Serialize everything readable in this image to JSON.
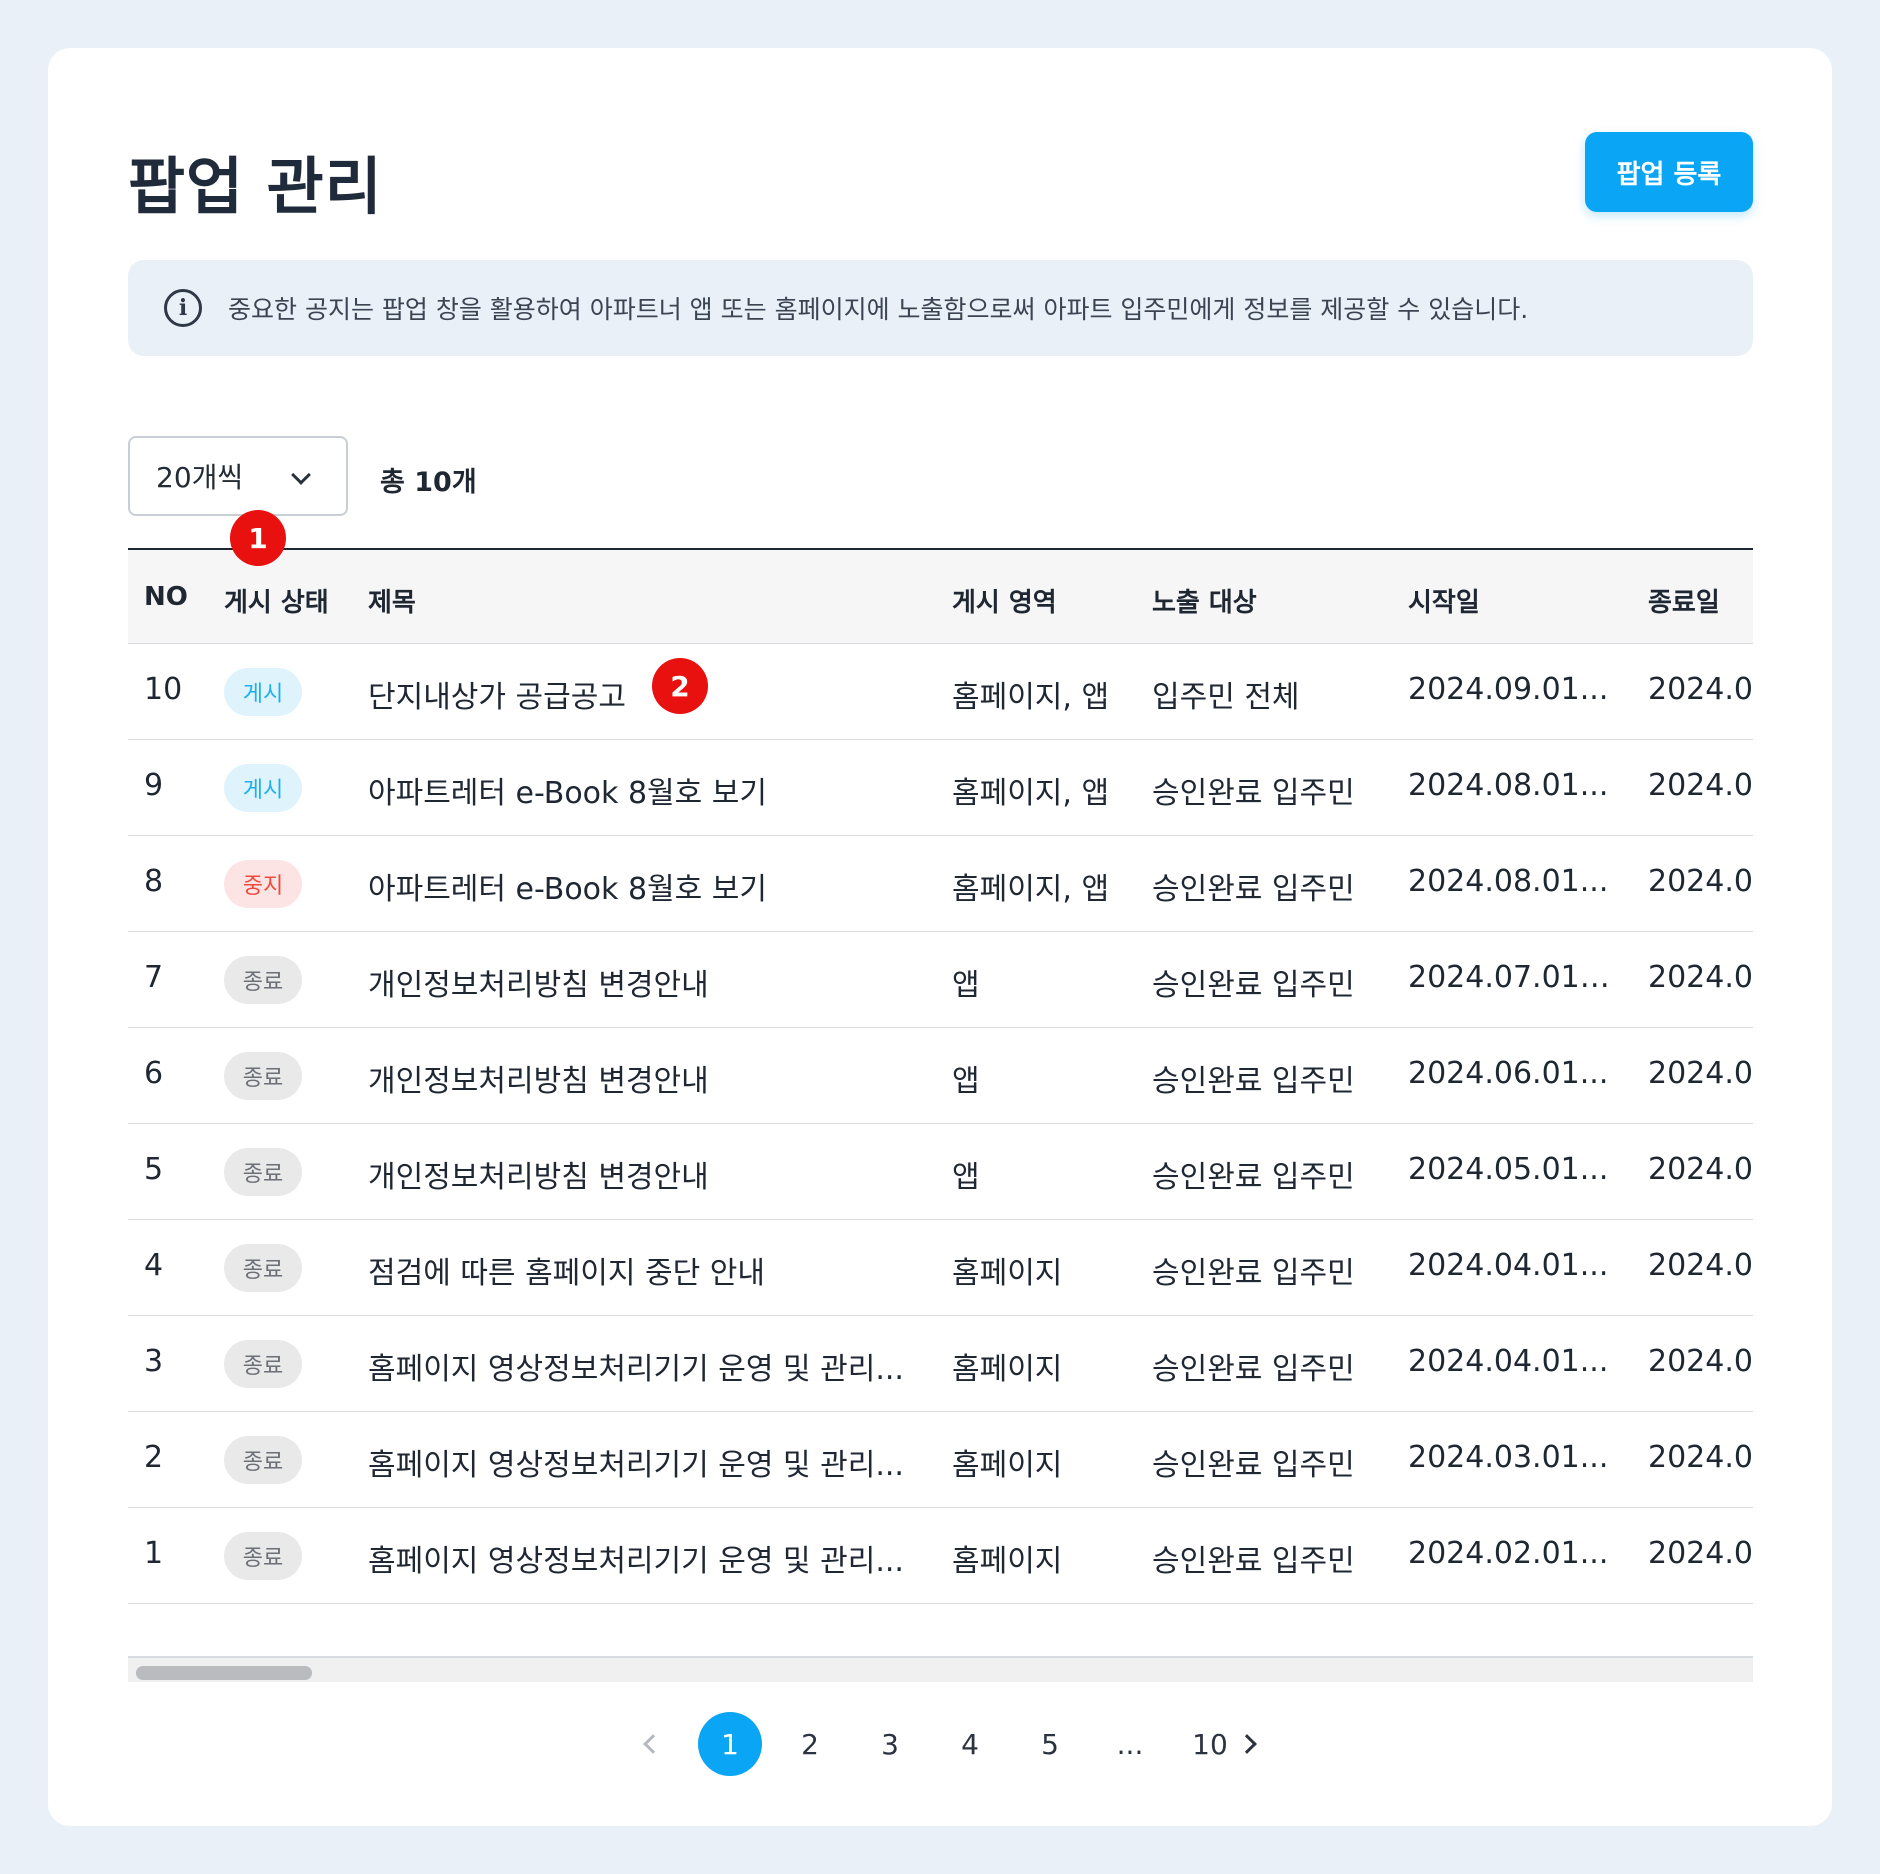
{
  "header": {
    "title": "팝업 관리",
    "register_button": "팝업 등록"
  },
  "notice": {
    "icon": "info-icon",
    "icon_glyph": "i",
    "text": "중요한 공지는 팝업 창을 활용하여 아파트너 앱 또는 홈페이지에 노출함으로써 아파트 입주민에게 정보를 제공할 수 있습니다."
  },
  "controls": {
    "page_size": "20개씩",
    "total": "총 10개"
  },
  "markers": {
    "one": "1",
    "two": "2"
  },
  "table": {
    "columns": {
      "no": "NO",
      "status": "게시 상태",
      "title": "제목",
      "area": "게시 영역",
      "target": "노출 대상",
      "start": "시작일",
      "end": "종료일"
    },
    "rows": [
      {
        "no": "10",
        "status": "게시",
        "title": "단지내상가 공급공고",
        "area": "홈페이지, 앱",
        "target": "입주민 전체",
        "start": "2024.09.01...",
        "end": "2024.0"
      },
      {
        "no": "9",
        "status": "게시",
        "title": "아파트레터 e-Book 8월호 보기",
        "area": "홈페이지, 앱",
        "target": "승인완료 입주민",
        "start": "2024.08.01...",
        "end": "2024.0"
      },
      {
        "no": "8",
        "status": "중지",
        "title": "아파트레터 e-Book 8월호 보기",
        "area": "홈페이지, 앱",
        "target": "승인완료 입주민",
        "start": "2024.08.01...",
        "end": "2024.0"
      },
      {
        "no": "7",
        "status": "종료",
        "title": "개인정보처리방침 변경안내",
        "area": "앱",
        "target": "승인완료 입주민",
        "start": "2024.07.01 0...",
        "end": "2024.0"
      },
      {
        "no": "6",
        "status": "종료",
        "title": "개인정보처리방침 변경안내",
        "area": "앱",
        "target": "승인완료 입주민",
        "start": "2024.06.01...",
        "end": "2024.0"
      },
      {
        "no": "5",
        "status": "종료",
        "title": "개인정보처리방침 변경안내",
        "area": "앱",
        "target": "승인완료 입주민",
        "start": "2024.05.01...",
        "end": "2024.0"
      },
      {
        "no": "4",
        "status": "종료",
        "title": "점검에 따른 홈페이지 중단 안내",
        "area": "홈페이지",
        "target": "승인완료 입주민",
        "start": "2024.04.01...",
        "end": "2024.0"
      },
      {
        "no": "3",
        "status": "종료",
        "title": "홈페이지 영상정보처리기기 운영 및 관리...",
        "area": "홈페이지",
        "target": "승인완료 입주민",
        "start": "2024.04.01...",
        "end": "2024.0"
      },
      {
        "no": "2",
        "status": "종료",
        "title": "홈페이지 영상정보처리기기 운영 및 관리...",
        "area": "홈페이지",
        "target": "승인완료 입주민",
        "start": "2024.03.01...",
        "end": "2024.0"
      },
      {
        "no": "1",
        "status": "종료",
        "title": "홈페이지 영상정보처리기기 운영 및 관리...",
        "area": "홈페이지",
        "target": "승인완료 입주민",
        "start": "2024.02.01...",
        "end": "2024.0"
      }
    ]
  },
  "pagination": {
    "pages": [
      "1",
      "2",
      "3",
      "4",
      "5",
      "...",
      "10"
    ],
    "current": "1"
  },
  "colors": {
    "accent": "#0aa6f5",
    "marker": "#e8110f",
    "status_posted": "#1bb0f0",
    "status_stopped": "#ee4a3c",
    "status_ended": "#6b6f76"
  }
}
